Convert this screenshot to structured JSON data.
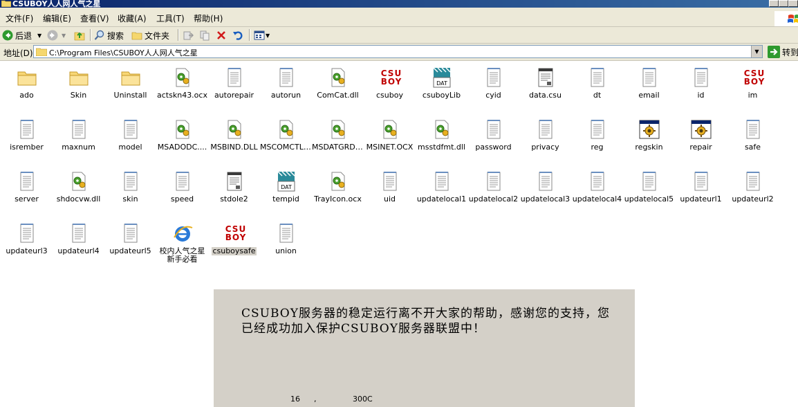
{
  "window": {
    "title": "CSUBOY人人网人气之星"
  },
  "menu": [
    "文件(F)",
    "编辑(E)",
    "查看(V)",
    "收藏(A)",
    "工具(T)",
    "帮助(H)"
  ],
  "toolbar": {
    "back": "后退",
    "search": "搜索",
    "folders": "文件夹"
  },
  "address": {
    "label": "地址(D)",
    "value": "C:\\Program Files\\CSUBOY人人网人气之星",
    "go": "转到"
  },
  "files": [
    {
      "name": "ado",
      "icon": "folder-icon"
    },
    {
      "name": "Skin",
      "icon": "folder-icon"
    },
    {
      "name": "Uninstall",
      "icon": "folder-icon"
    },
    {
      "name": "actskn43.ocx",
      "icon": "dll-icon"
    },
    {
      "name": "autorepair",
      "icon": "text-file-icon"
    },
    {
      "name": "autorun",
      "icon": "text-file-icon"
    },
    {
      "name": "ComCat.dll",
      "icon": "dll-icon"
    },
    {
      "name": "csuboy",
      "icon": "csuboy-logo-icon"
    },
    {
      "name": "csuboyLib",
      "icon": "dat-icon"
    },
    {
      "name": "cyid",
      "icon": "text-file-icon"
    },
    {
      "name": "data.csu",
      "icon": "data-file-icon"
    },
    {
      "name": "dt",
      "icon": "text-file-icon"
    },
    {
      "name": "email",
      "icon": "text-file-icon"
    },
    {
      "name": "id",
      "icon": "text-file-icon"
    },
    {
      "name": "im",
      "icon": "csuboy-logo-icon"
    },
    {
      "name": "isrember",
      "icon": "text-file-icon"
    },
    {
      "name": "maxnum",
      "icon": "text-file-icon"
    },
    {
      "name": "model",
      "icon": "text-file-icon"
    },
    {
      "name": "MSADODC....",
      "icon": "dll-icon"
    },
    {
      "name": "MSBIND.DLL",
      "icon": "dll-icon"
    },
    {
      "name": "MSCOMCTL....",
      "icon": "dll-icon"
    },
    {
      "name": "MSDATGRD....",
      "icon": "dll-icon"
    },
    {
      "name": "MSINET.OCX",
      "icon": "dll-icon"
    },
    {
      "name": "msstdfmt.dll",
      "icon": "dll-icon"
    },
    {
      "name": "password",
      "icon": "text-file-icon"
    },
    {
      "name": "privacy",
      "icon": "text-file-icon"
    },
    {
      "name": "reg",
      "icon": "text-file-icon"
    },
    {
      "name": "regskin",
      "icon": "app-icon"
    },
    {
      "name": "repair",
      "icon": "app-icon"
    },
    {
      "name": "safe",
      "icon": "text-file-icon"
    },
    {
      "name": "server",
      "icon": "text-file-icon"
    },
    {
      "name": "shdocvw.dll",
      "icon": "dll-icon"
    },
    {
      "name": "skin",
      "icon": "text-file-icon"
    },
    {
      "name": "speed",
      "icon": "text-file-icon"
    },
    {
      "name": "stdole2",
      "icon": "data-file-icon"
    },
    {
      "name": "tempid",
      "icon": "dat-icon"
    },
    {
      "name": "TrayIcon.ocx",
      "icon": "dll-icon"
    },
    {
      "name": "uid",
      "icon": "text-file-icon"
    },
    {
      "name": "updatelocal1",
      "icon": "text-file-icon"
    },
    {
      "name": "updatelocal2",
      "icon": "text-file-icon"
    },
    {
      "name": "updatelocal3",
      "icon": "text-file-icon"
    },
    {
      "name": "updatelocal4",
      "icon": "text-file-icon"
    },
    {
      "name": "updatelocal5",
      "icon": "text-file-icon"
    },
    {
      "name": "updateurl1",
      "icon": "text-file-icon"
    },
    {
      "name": "updateurl2",
      "icon": "text-file-icon"
    },
    {
      "name": "updateurl3",
      "icon": "text-file-icon"
    },
    {
      "name": "updateurl4",
      "icon": "text-file-icon"
    },
    {
      "name": "updateurl5",
      "icon": "text-file-icon"
    },
    {
      "name": "校内人气之星新手必看",
      "icon": "ie-icon"
    },
    {
      "name": "csuboysafe",
      "icon": "csuboy-logo-icon",
      "selected": true
    },
    {
      "name": "union",
      "icon": "text-file-icon"
    }
  ],
  "logo_text": {
    "line1": "CSU",
    "line2": "BOY"
  },
  "dat_badge": "DAT",
  "popup": {
    "message": "CSUBOY服务器的稳定运行离不开大家的帮助，感谢您的支持，您已经成功加入保护CSUBOY服务器联盟中！",
    "stat1": "16",
    "stat_sep": ",",
    "stat2": "300C"
  },
  "colors": {
    "titlebar": "#0a246a",
    "chrome": "#ece9d8",
    "popup_bg": "#d4d0c8",
    "logo_red": "#c00000"
  }
}
